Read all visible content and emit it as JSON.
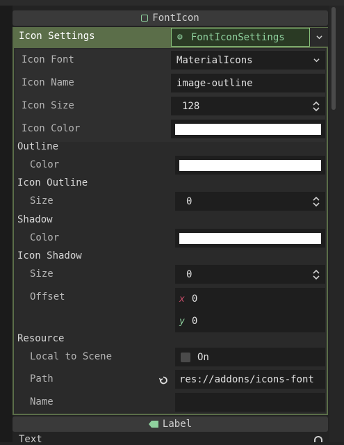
{
  "header": {
    "title": "FontIcon",
    "footer_title": "Label",
    "cut_text": "Text"
  },
  "icon_settings": {
    "label": "Icon Settings",
    "resource": "FontIconSettings"
  },
  "properties": {
    "icon_font": {
      "label": "Icon Font",
      "value": "MaterialIcons"
    },
    "icon_name": {
      "label": "Icon Name",
      "value": "image-outline"
    },
    "icon_size": {
      "label": "Icon Size",
      "value": "128"
    },
    "icon_color": {
      "label": "Icon Color",
      "color": "#ffffff"
    }
  },
  "outline": {
    "group": "Outline",
    "color_label": "Color",
    "color": "#ffffff"
  },
  "icon_outline": {
    "group": "Icon Outline",
    "size_label": "Size",
    "size": "0"
  },
  "shadow": {
    "group": "Shadow",
    "color_label": "Color",
    "color": "#ffffff"
  },
  "icon_shadow": {
    "group": "Icon Shadow",
    "size_label": "Size",
    "size": "0",
    "offset_label": "Offset",
    "x_label": "x",
    "x": "0",
    "y_label": "y",
    "y": "0"
  },
  "resource": {
    "group": "Resource",
    "local_label": "Local to Scene",
    "local_value": "On",
    "path_label": "Path",
    "path": "res://addons/icons-font",
    "name_label": "Name",
    "name": ""
  },
  "colors": {
    "accent": "#5b6e49",
    "accent_text": "#8fd19e"
  }
}
